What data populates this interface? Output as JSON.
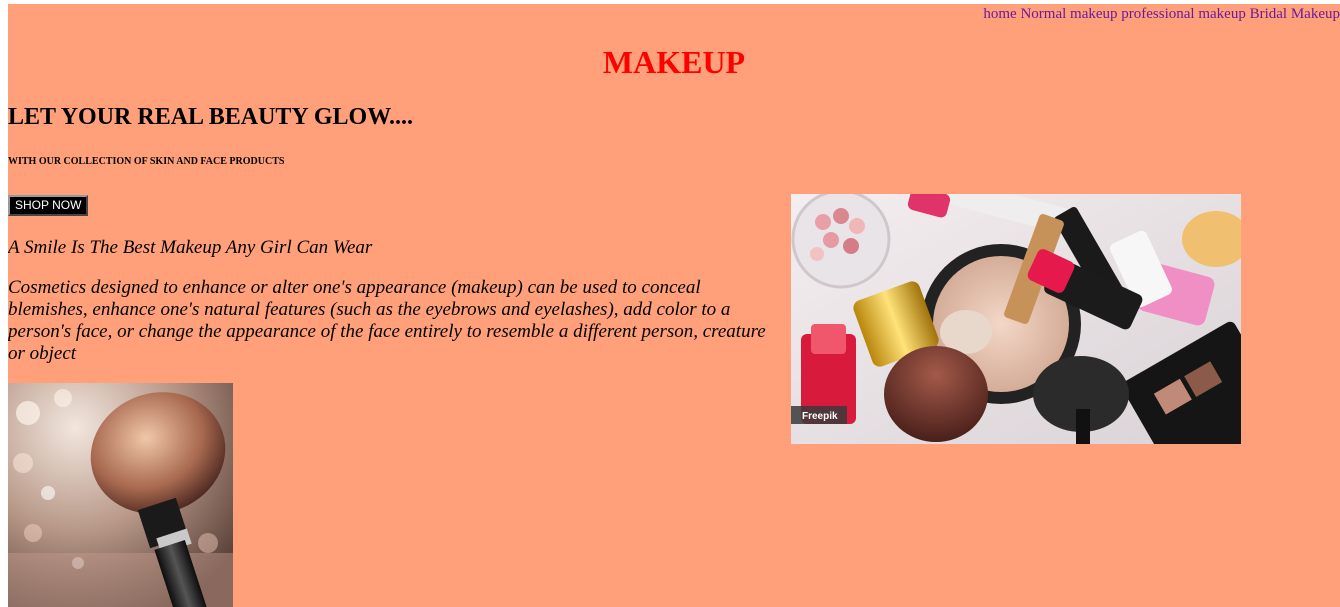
{
  "nav": {
    "items": [
      {
        "label": "home"
      },
      {
        "label": "Normal makeup"
      },
      {
        "label": "professional makeup"
      },
      {
        "label": "Bridal Makeup"
      }
    ]
  },
  "header": {
    "title": "MAKEUP"
  },
  "hero": {
    "headline": "LET YOUR REAL BEAUTY GLOW....",
    "subheadline": "WITH OUR COLLECTION OF SKIN AND FACE PRODUCTS",
    "cta_label": "SHOP NOW",
    "quote": "A Smile Is The Best Makeup Any Girl Can Wear",
    "description": "Cosmetics designed to enhance or alter one's appearance (makeup) can be used to conceal blemishes, enhance one's natural features (such as the eyebrows and eyelashes), add color to a person's face, or change the appearance of the face entirely to resemble a different person, creature or object"
  },
  "images": {
    "cosmetics_watermark": "Freepik"
  },
  "colors": {
    "page_background": "#ffa07a",
    "title": "#ff0000",
    "nav_link": "#6a1b9a",
    "button_background": "#000000",
    "button_text": "#ffffff"
  }
}
